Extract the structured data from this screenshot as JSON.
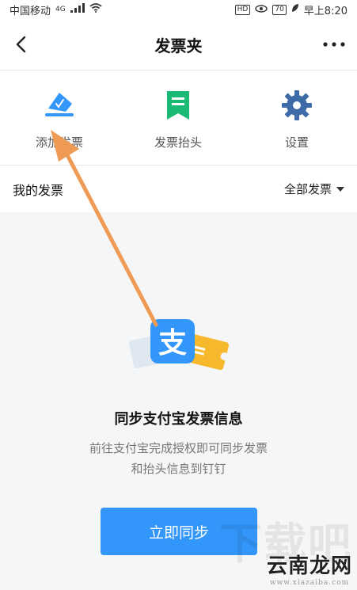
{
  "status_bar": {
    "carrier": "中国移动",
    "network": "4G",
    "hd_label": "HD",
    "battery": "70",
    "time": "早上8:20"
  },
  "nav": {
    "title": "发票夹",
    "back_icon": "chevron-left-icon",
    "more_icon": "more-dots-icon"
  },
  "shortcuts": [
    {
      "label": "添加发票",
      "icon": "add-invoice-icon",
      "color": "#3296fa"
    },
    {
      "label": "发票抬头",
      "icon": "invoice-title-icon",
      "color": "#1bba74"
    },
    {
      "label": "设置",
      "icon": "gear-icon",
      "color": "#3f6aa8"
    }
  ],
  "section": {
    "title": "我的发票",
    "filter_label": "全部发票"
  },
  "empty_state": {
    "title": "同步支付宝发票信息",
    "desc_line1": "前往支付宝完成授权即可同步发票",
    "desc_line2": "和抬头信息到钉钉",
    "illustration_glyph": "支",
    "button_label": "立即同步"
  },
  "watermark": {
    "main": "云南龙网",
    "url": "www.xiazaiba.com",
    "bg": "下载吧"
  },
  "colors": {
    "accent": "#3296fa",
    "arrow": "#ef9a55"
  }
}
